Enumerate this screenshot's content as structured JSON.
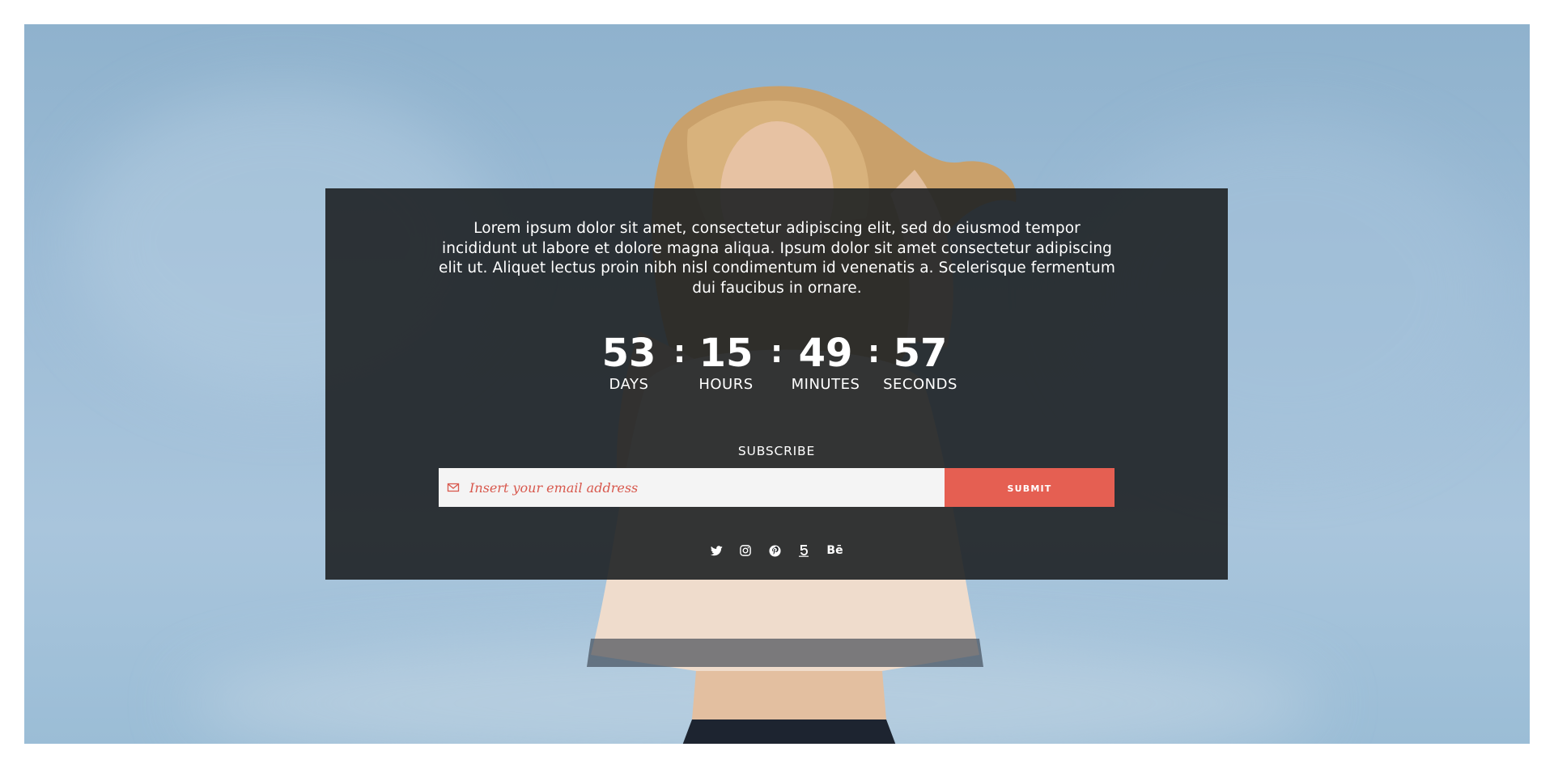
{
  "intro": {
    "text": "Lorem ipsum dolor sit amet, consectetur adipiscing elit, sed do eiusmod tempor incididunt ut labore et dolore magna aliqua. Ipsum dolor sit amet consectetur adipiscing elit ut. Aliquet lectus proin nibh nisl condimentum id venenatis a. Scelerisque fermentum dui faucibus in ornare."
  },
  "countdown": {
    "separator": ":",
    "units": [
      {
        "value": "53",
        "label": "DAYS"
      },
      {
        "value": "15",
        "label": "HOURS"
      },
      {
        "value": "49",
        "label": "MINUTES"
      },
      {
        "value": "57",
        "label": "SECONDS"
      }
    ]
  },
  "subscribe": {
    "label": "SUBSCRIBE",
    "email_placeholder": "Insert your email address",
    "email_value": "",
    "submit_label": "submit"
  },
  "socials": {
    "items": [
      {
        "icon": "twitter-icon"
      },
      {
        "icon": "instagram-icon"
      },
      {
        "icon": "pinterest-icon"
      },
      {
        "icon": "500px-icon"
      },
      {
        "icon": "behance-icon",
        "text": "Bē"
      }
    ]
  },
  "colors": {
    "accent": "#e55f52",
    "panel": "#1e2124",
    "sky": "#9dbcd6"
  }
}
